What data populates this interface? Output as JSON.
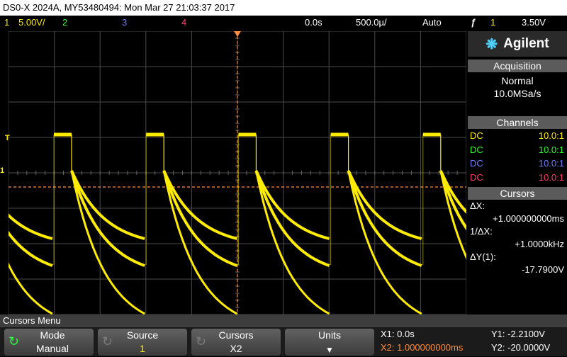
{
  "title": "DS0-X 2024A, MY53480494: Mon Mar 27 21:03:37 2017",
  "statusbar": {
    "ch1_num": "1",
    "ch1_scale": "5.00V/",
    "ch2_num": "2",
    "ch3_num": "3",
    "ch4_num": "4",
    "delay": "0.0s",
    "timebase": "500.0µ/",
    "trigger_mode": "Auto",
    "trigger_icon": "ƒ",
    "trigger_source": "1",
    "trigger_level": "3.50V"
  },
  "screen": {
    "trigger_marker": "T",
    "ground_marker": "1"
  },
  "panel": {
    "logo": "Agilent",
    "logo_icon": "agilent-spark-icon",
    "acquisition_header": "Acquisition",
    "acq_mode": "Normal",
    "acq_rate": "10.0MSa/s",
    "channels_header": "Channels",
    "channels": [
      {
        "coupling": "DC",
        "probe": "10.0:1",
        "color": "#ffec00"
      },
      {
        "coupling": "DC",
        "probe": "10.0:1",
        "color": "#27ff27"
      },
      {
        "coupling": "DC",
        "probe": "10.0:1",
        "color": "#6d7bff"
      },
      {
        "coupling": "DC",
        "probe": "10.0:1",
        "color": "#ff3a6a"
      }
    ],
    "cursors_header": "Cursors",
    "dx_label": "ΔX:",
    "dx_value": "+1.000000000ms",
    "inv_dx_label": "1/ΔX:",
    "inv_dx_value": "+1.0000kHz",
    "dy_label": "ΔY(1):",
    "dy_value": "-17.7900V"
  },
  "menu": {
    "label": "Cursors Menu",
    "keys": [
      {
        "top": "Mode",
        "bottom": "Manual"
      },
      {
        "top": "Source",
        "bottom": "1"
      },
      {
        "top": "Cursors",
        "bottom": "X2"
      },
      {
        "top": "Units",
        "bottom": ""
      }
    ],
    "x1": "X1: 0.0s",
    "x2": "X2: 1.000000000ms",
    "y1": "Y1: -2.2100V",
    "y2": "Y2: -20.0000V"
  },
  "colors": {
    "ch1": "#ffec00",
    "ch2": "#27ff27",
    "ch3": "#6d7bff",
    "ch4": "#ff3a6a",
    "cursor": "#ff8c3a"
  }
}
